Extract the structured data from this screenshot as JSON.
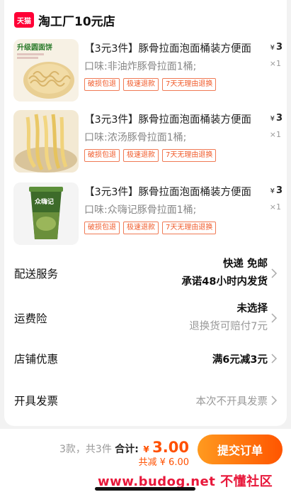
{
  "store": {
    "badge": "天猫",
    "name": "淘工厂10元店"
  },
  "items": [
    {
      "title": "【3元3件】豚骨拉面泡面桶装方便面",
      "sku": "口味:非油炸豚骨拉面1桶;",
      "currency": "¥",
      "price": "3",
      "qty": "×1",
      "thumb_caption": "升级圆面饼",
      "tags": [
        "破损包退",
        "极速退款",
        "7天无理由退换"
      ]
    },
    {
      "title": "【3元3件】豚骨拉面泡面桶装方便面",
      "sku": "口味:浓汤豚骨拉面1桶;",
      "currency": "¥",
      "price": "3",
      "qty": "×1",
      "thumb_caption": "",
      "tags": [
        "破损包退",
        "极速退款",
        "7天无理由退换"
      ]
    },
    {
      "title": "【3元3件】豚骨拉面泡面桶装方便面",
      "sku": "口味:众嗨记豚骨拉面1桶;",
      "currency": "¥",
      "price": "3",
      "qty": "×1",
      "thumb_caption": "众嗨记",
      "tags": [
        "破损包退",
        "极速退款",
        "7天无理由退换"
      ]
    }
  ],
  "rows": {
    "delivery": {
      "label": "配送服务",
      "line1": "快递 免邮",
      "line2": "承诺48小时内发货"
    },
    "insurance": {
      "label": "运费险",
      "line1": "未选择",
      "line2": "退换货可赔付7元"
    },
    "coupon": {
      "label": "店铺优惠",
      "value": "满6元减3元"
    },
    "invoice": {
      "label": "开具发票",
      "value": "本次不开具发票"
    }
  },
  "bottom": {
    "count": "3款，共3件",
    "total_label": "合计:",
    "currency": "¥",
    "total": "3.00",
    "discount": "共减 ¥ 6.00",
    "submit": "提交订单"
  },
  "watermark": "www.budog.net 不懂社区",
  "colors": {
    "accent": "#ff5000",
    "tmall_red": "#ff0036",
    "tag": "#f05a2a"
  }
}
